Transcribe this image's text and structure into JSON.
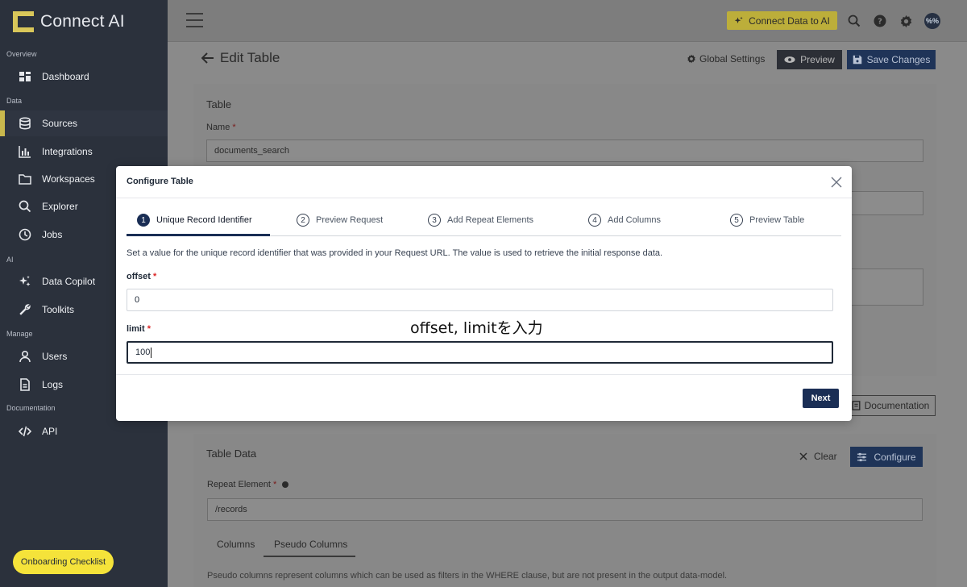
{
  "app": {
    "name": "Connect AI"
  },
  "sidebar": {
    "sections": {
      "overview": "Overview",
      "data": "Data",
      "ai": "AI",
      "manage": "Manage",
      "documentation": "Documentation"
    },
    "items": [
      {
        "label": "Dashboard",
        "icon": "dashboard-icon"
      },
      {
        "label": "Sources",
        "icon": "database-icon",
        "active": true
      },
      {
        "label": "Integrations",
        "icon": "bar-chart-icon"
      },
      {
        "label": "Workspaces",
        "icon": "folder-icon"
      },
      {
        "label": "Explorer",
        "icon": "search-icon"
      },
      {
        "label": "Jobs",
        "icon": "clock-icon"
      },
      {
        "label": "Data Copilot",
        "icon": "sparkle-icon"
      },
      {
        "label": "Toolkits",
        "icon": "wrench-icon"
      },
      {
        "label": "Users",
        "icon": "user-icon"
      },
      {
        "label": "Logs",
        "icon": "document-icon"
      },
      {
        "label": "API",
        "icon": "code-icon"
      }
    ],
    "onboarding": "Onboarding Checklist"
  },
  "topbar": {
    "connect_button": "Connect Data to AI",
    "avatar_text": "%%"
  },
  "page": {
    "title": "Edit Table",
    "global_settings": "Global Settings",
    "preview": "Preview",
    "save_changes": "Save Changes",
    "table_card": {
      "title": "Table",
      "name_label": "Name",
      "name_value": "documents_search"
    },
    "documentation_button": "Documentation",
    "table_data": {
      "title": "Table Data",
      "clear": "Clear",
      "configure": "Configure",
      "repeat_label": "Repeat Element",
      "repeat_value": "/records",
      "tabs": [
        "Columns",
        "Pseudo Columns"
      ],
      "active_tab": "Pseudo Columns",
      "helper": "Pseudo columns represent columns which can be used as filters in the WHERE clause, but are not present in the output data-model."
    }
  },
  "modal": {
    "title": "Configure Table",
    "steps": [
      {
        "num": "1",
        "label": "Unique Record Identifier",
        "active": true
      },
      {
        "num": "2",
        "label": "Preview Request"
      },
      {
        "num": "3",
        "label": "Add Repeat Elements"
      },
      {
        "num": "4",
        "label": "Add Columns"
      },
      {
        "num": "5",
        "label": "Preview Table"
      }
    ],
    "instruction": "Set a value for the unique record identifier that was provided in your Request URL. The value is used to retrieve the initial response data.",
    "fields": [
      {
        "label": "offset",
        "value": "0"
      },
      {
        "label": "limit",
        "value": "100"
      }
    ],
    "annotation": "offset, limitを入力",
    "next": "Next"
  },
  "colors": {
    "sidebar_bg": "#2b313c",
    "accent_yellow": "#f5e33a",
    "primary_navy": "#1a2e55"
  }
}
